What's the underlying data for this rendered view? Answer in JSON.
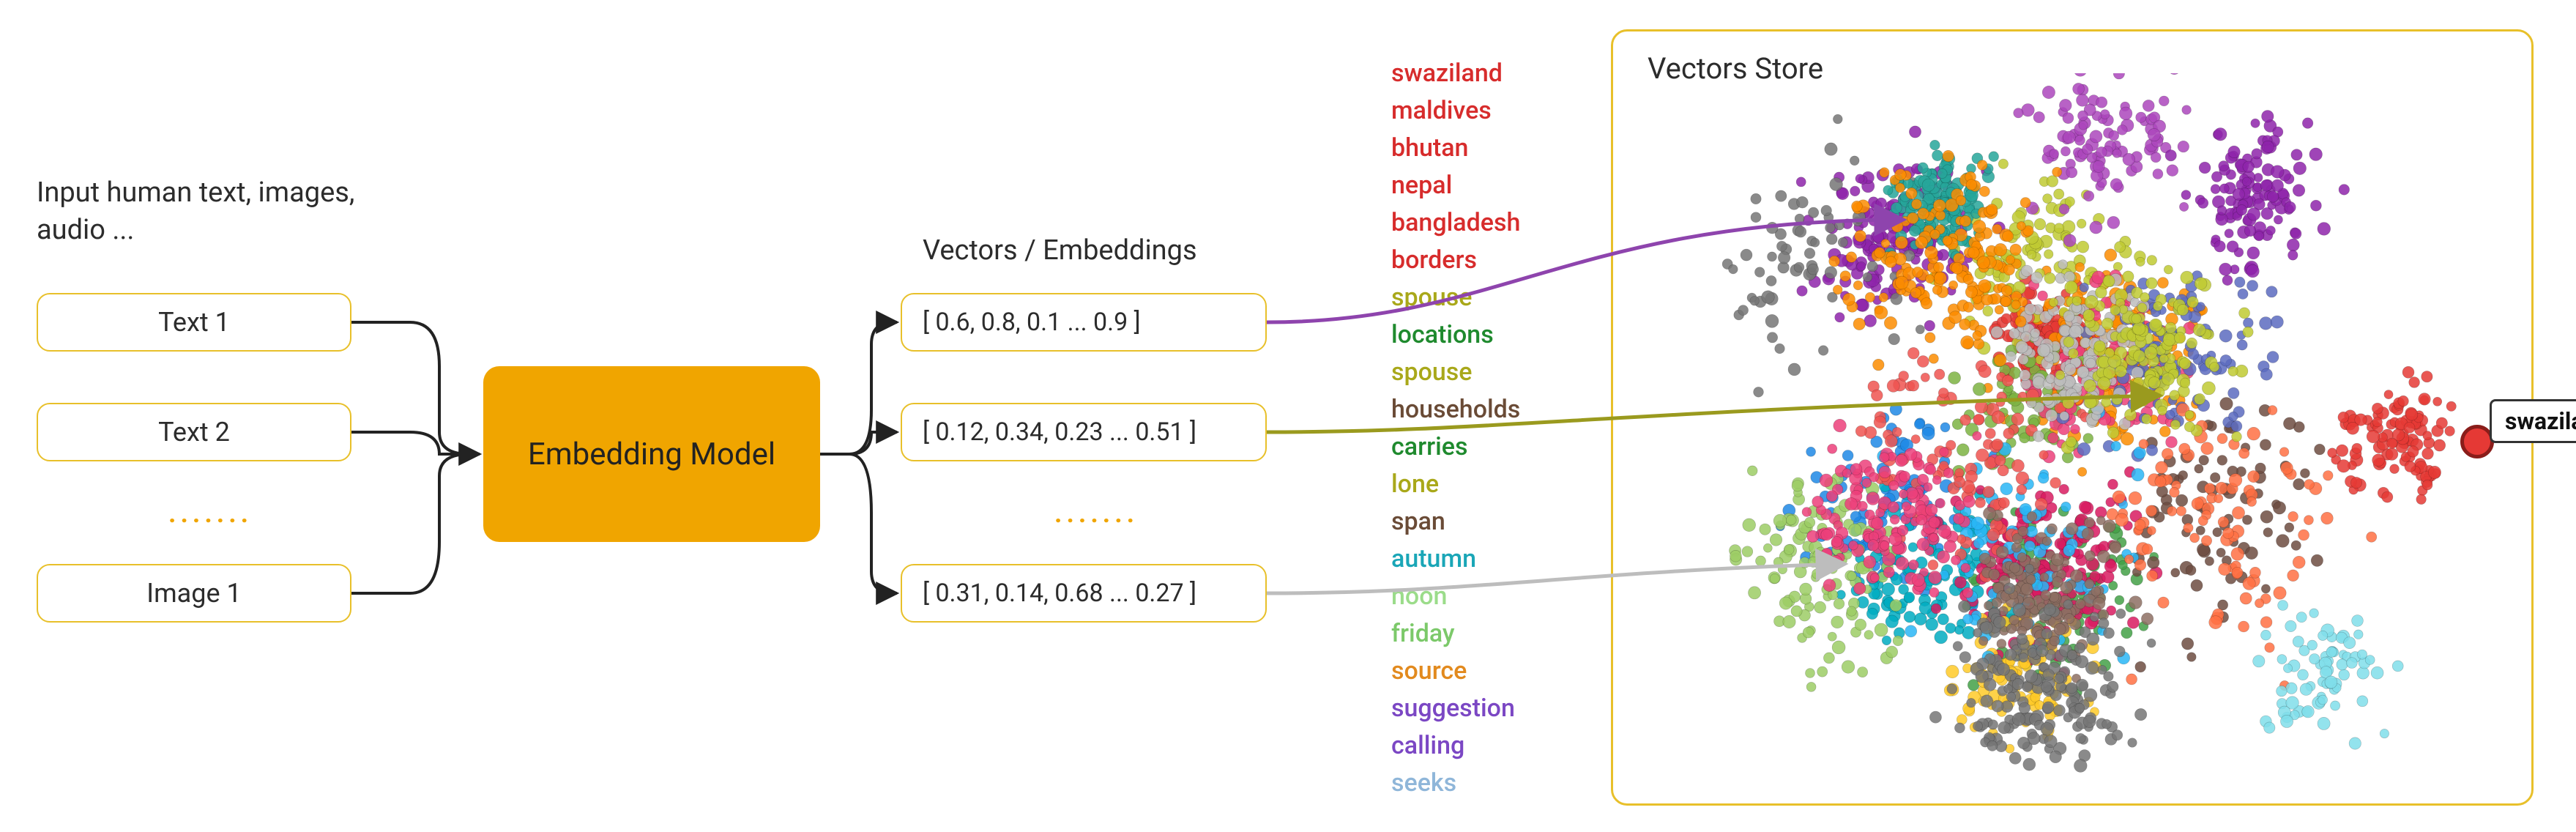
{
  "input_section": {
    "heading": "Input human text, images, audio ...",
    "items": [
      "Text 1",
      "Text 2",
      "Image 1"
    ],
    "ellipsis": "......."
  },
  "model": {
    "label": "Embedding Model"
  },
  "vectors_section": {
    "heading": "Vectors / Embeddings",
    "items": [
      "[ 0.6, 0.8, 0.1 ... 0.9 ]",
      "[ 0.12, 0.34, 0.23 ... 0.51 ]",
      "[ 0.31, 0.14, 0.68 ... 0.27 ]"
    ],
    "ellipsis": "......."
  },
  "word_list": [
    {
      "text": "swaziland",
      "color": "#d72c2c"
    },
    {
      "text": "maldives",
      "color": "#d72c2c"
    },
    {
      "text": "bhutan",
      "color": "#d72c2c"
    },
    {
      "text": "nepal",
      "color": "#d72c2c"
    },
    {
      "text": "bangladesh",
      "color": "#d72c2c"
    },
    {
      "text": "borders",
      "color": "#d72c2c"
    },
    {
      "text": "spouse",
      "color": "#a9a81a"
    },
    {
      "text": "locations",
      "color": "#1f8a2e"
    },
    {
      "text": "spouse",
      "color": "#a9a81a"
    },
    {
      "text": "households",
      "color": "#6a4b36"
    },
    {
      "text": "carries",
      "color": "#1f8a2e"
    },
    {
      "text": "lone",
      "color": "#a9a81a"
    },
    {
      "text": "span",
      "color": "#6a4b36"
    },
    {
      "text": "autumn",
      "color": "#1aa6b7"
    },
    {
      "text": "noon",
      "color": "#9bdc8a"
    },
    {
      "text": "friday",
      "color": "#7cc96a"
    },
    {
      "text": "source",
      "color": "#e28a1e"
    },
    {
      "text": "suggestion",
      "color": "#7b47c4"
    },
    {
      "text": "calling",
      "color": "#7b47c4"
    },
    {
      "text": "seeks",
      "color": "#8fb6d9"
    }
  ],
  "store": {
    "title": "Vectors Store",
    "highlight_label": "swaziland"
  },
  "cluster_palette": [
    "#e53935",
    "#8e24aa",
    "#1e88e5",
    "#43a047",
    "#fb8c00",
    "#c0ca33",
    "#00acc1",
    "#d81b60",
    "#6d4c41",
    "#757575",
    "#ffca28",
    "#26a69a",
    "#7cb342",
    "#ec407a",
    "#5c6bc0",
    "#9ccc65",
    "#ab47bc",
    "#29b6f6",
    "#ef5350",
    "#8d6e63",
    "#bdbdbd",
    "#ff7043"
  ],
  "arrow_colors": {
    "v1": "#8e44ad",
    "v2": "#9a9a1e",
    "v3": "#bdbdbd"
  }
}
